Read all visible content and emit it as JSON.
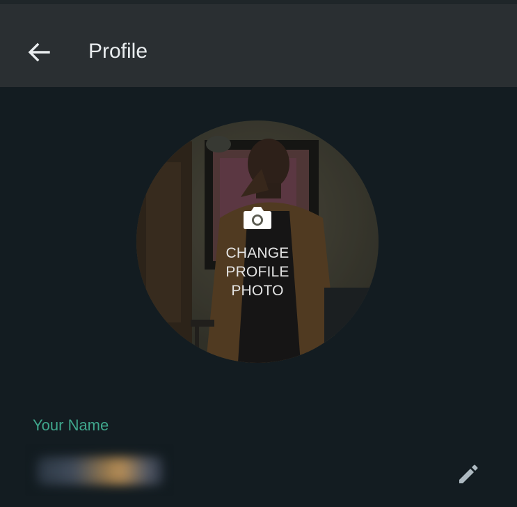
{
  "header": {
    "title": "Profile",
    "back_icon": "arrow-left-icon"
  },
  "avatar": {
    "change_label": "CHANGE\nPROFILE\nPHOTO",
    "camera_icon": "camera-icon"
  },
  "name_section": {
    "label": "Your Name",
    "value": "",
    "edit_icon": "pencil-icon"
  },
  "colors": {
    "background": "#131c21",
    "header": "#2a2f32",
    "accent": "#3fa68c",
    "text": "#e9edef",
    "icon": "#aebac1"
  }
}
